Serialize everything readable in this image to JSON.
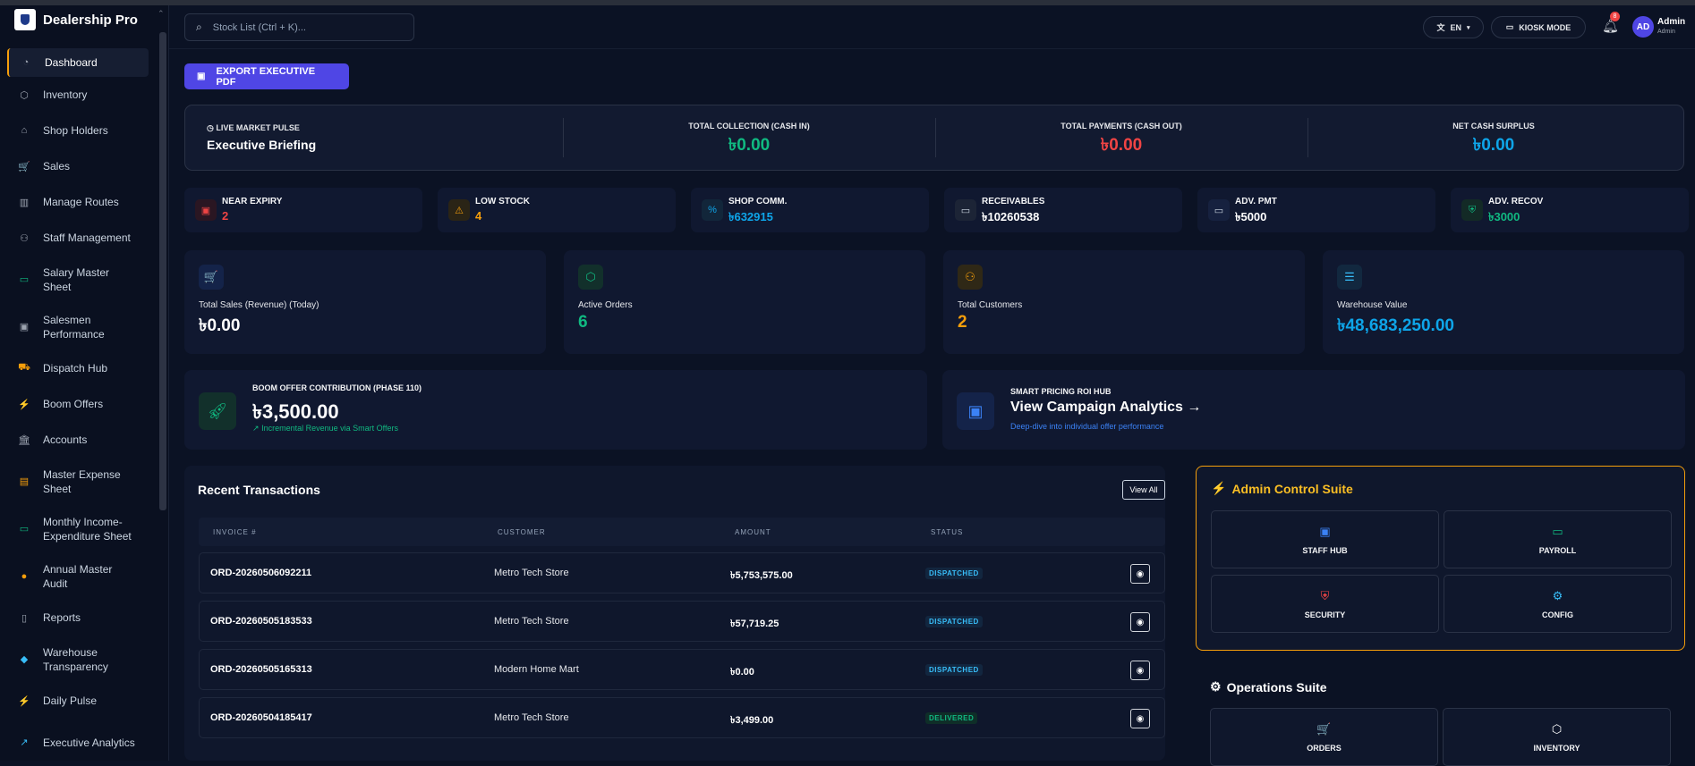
{
  "app": {
    "name": "Dealership Pro"
  },
  "sidebar": {
    "items": [
      {
        "label": "Dashboard",
        "icon": "dashboard-icon",
        "glyph": "◔",
        "color": "#9ca3af"
      },
      {
        "label": "Inventory",
        "icon": "box-icon",
        "glyph": "⬡",
        "color": "#9ca3af"
      },
      {
        "label": "Shop Holders",
        "icon": "store-icon",
        "glyph": "⌂",
        "color": "#9ca3af"
      },
      {
        "label": "Sales",
        "icon": "cart-icon",
        "glyph": "🛒",
        "color": "#9ca3af"
      },
      {
        "label": "Manage Routes",
        "icon": "map-icon",
        "glyph": "▥",
        "color": "#9ca3af"
      },
      {
        "label": "Staff Management",
        "icon": "users-icon",
        "glyph": "⚇",
        "color": "#9ca3af"
      },
      {
        "label": "Salary Master Sheet",
        "icon": "wallet-icon",
        "glyph": "▭",
        "color": "#10b981"
      },
      {
        "label": "Salesmen Performance",
        "icon": "badge-icon",
        "glyph": "▣",
        "color": "#9ca3af"
      },
      {
        "label": "Dispatch Hub",
        "icon": "truck-icon",
        "glyph": "⛟",
        "color": "#f59e0b"
      },
      {
        "label": "Boom Offers",
        "icon": "bolt-icon",
        "glyph": "⚡",
        "color": "#9ca3af"
      },
      {
        "label": "Accounts",
        "icon": "bank-icon",
        "glyph": "🏛",
        "color": "#9ca3af"
      },
      {
        "label": "Master Expense Sheet",
        "icon": "receipt-icon",
        "glyph": "▤",
        "color": "#f59e0b"
      },
      {
        "label": "Monthly Income-Expenditure Sheet",
        "icon": "money-icon",
        "glyph": "▭",
        "color": "#10b981"
      },
      {
        "label": "Annual Master Audit",
        "icon": "lightbulb-icon",
        "glyph": "●",
        "color": "#f59e0b"
      },
      {
        "label": "Reports",
        "icon": "file-icon",
        "glyph": "▯",
        "color": "#9ca3af"
      },
      {
        "label": "Warehouse Transparency",
        "icon": "cube-icon",
        "glyph": "◆",
        "color": "#38bdf8"
      },
      {
        "label": "Daily Pulse",
        "icon": "bolt-icon",
        "glyph": "⚡",
        "color": "#f59e0b"
      },
      {
        "label": "Executive Analytics",
        "icon": "chart-icon",
        "glyph": "↗",
        "color": "#38bdf8"
      }
    ]
  },
  "header": {
    "search_placeholder": "Stock List (Ctrl + K)...",
    "lang": "EN",
    "kiosk": "KIOSK MODE",
    "notif_count": "8",
    "avatar_initials": "AD",
    "user_name": "Admin",
    "user_role": "Admin"
  },
  "export_label": "EXPORT EXECUTIVE PDF",
  "pulse": {
    "tag": "LIVE MARKET PULSE",
    "title": "Executive Briefing",
    "stats": [
      {
        "label": "TOTAL COLLECTION (CASH IN)",
        "value": "৳0.00",
        "color": "#10b981"
      },
      {
        "label": "TOTAL PAYMENTS (CASH OUT)",
        "value": "৳0.00",
        "color": "#ef4444"
      },
      {
        "label": "NET CASH SURPLUS",
        "value": "৳0.00",
        "color": "#0ea5e9"
      }
    ]
  },
  "mini": [
    {
      "label": "NEAR EXPIRY",
      "value": "2",
      "color": "#ef4444",
      "icon": "calendar-icon",
      "glyph": "▣",
      "bg": "#2a1622"
    },
    {
      "label": "LOW STOCK",
      "value": "4",
      "color": "#f59e0b",
      "icon": "warning-icon",
      "glyph": "⚠",
      "bg": "#2a2416"
    },
    {
      "label": "SHOP COMM.",
      "value": "৳632915",
      "color": "#0ea5e9",
      "icon": "percent-icon",
      "glyph": "%",
      "bg": "#12263a"
    },
    {
      "label": "RECEIVABLES",
      "value": "৳10260538",
      "color": "#ffffff",
      "icon": "wallet-icon",
      "glyph": "▭",
      "bg": "#1c2436"
    },
    {
      "label": "ADV. PMT",
      "value": "৳5000",
      "color": "#ffffff",
      "icon": "cash-icon",
      "glyph": "▭",
      "bg": "#16213f"
    },
    {
      "label": "ADV. RECOV",
      "value": "৳3000",
      "color": "#10b981",
      "icon": "shield-icon",
      "glyph": "⛨",
      "bg": "#132a26"
    }
  ],
  "kpis": [
    {
      "label": "Total Sales (Revenue) (Today)",
      "value": "৳0.00",
      "color": "#ffffff",
      "icon": "cart-icon",
      "glyph": "🛒",
      "icolor": "#3b82f6",
      "bg": "#142349"
    },
    {
      "label": "Active Orders",
      "value": "6",
      "color": "#10b981",
      "icon": "box-icon",
      "glyph": "⬡",
      "icolor": "#10b981",
      "bg": "#12302b"
    },
    {
      "label": "Total Customers",
      "value": "2",
      "color": "#f59e0b",
      "icon": "users-icon",
      "glyph": "⚇",
      "icolor": "#f59e0b",
      "bg": "#2f2816"
    },
    {
      "label": "Warehouse Value",
      "value": "৳48,683,250.00",
      "color": "#0ea5e9",
      "icon": "database-icon",
      "glyph": "☰",
      "icolor": "#38bdf8",
      "bg": "#12283f"
    }
  ],
  "boom": {
    "label": "BOOM OFFER CONTRIBUTION (PHASE 110)",
    "value": "৳3,500.00",
    "sub": "Incremental Revenue via Smart Offers"
  },
  "roi": {
    "label": "SMART PRICING ROI HUB",
    "title": "View Campaign Analytics",
    "sub": "Deep-dive into individual offer performance"
  },
  "transactions": {
    "title": "Recent Transactions",
    "view_all": "View All",
    "columns": [
      "INVOICE #",
      "CUSTOMER",
      "AMOUNT",
      "STATUS"
    ],
    "rows": [
      {
        "invoice": "ORD-20260506092211",
        "customer": "Metro Tech Store",
        "amount": "৳5,753,575.00",
        "status": "DISPATCHED"
      },
      {
        "invoice": "ORD-20260505183533",
        "customer": "Metro Tech Store",
        "amount": "৳57,719.25",
        "status": "DISPATCHED"
      },
      {
        "invoice": "ORD-20260505165313",
        "customer": "Modern Home Mart",
        "amount": "৳0.00",
        "status": "DISPATCHED"
      },
      {
        "invoice": "ORD-20260504185417",
        "customer": "Metro Tech Store",
        "amount": "৳3,499.00",
        "status": "DELIVERED"
      }
    ]
  },
  "admin_suite": {
    "title": "Admin Control Suite",
    "tiles": [
      {
        "label": "STAFF HUB",
        "icon": "id-card-icon",
        "glyph": "▣",
        "color": "#3b82f6"
      },
      {
        "label": "PAYROLL",
        "icon": "wallet-icon",
        "glyph": "▭",
        "color": "#10b981"
      },
      {
        "label": "SECURITY",
        "icon": "shield-icon",
        "glyph": "⛨",
        "color": "#ef4444"
      },
      {
        "label": "CONFIG",
        "icon": "gear-icon",
        "glyph": "⚙",
        "color": "#38bdf8"
      }
    ]
  },
  "ops_suite": {
    "title": "Operations Suite",
    "tiles": [
      {
        "label": "ORDERS",
        "icon": "cart-icon",
        "glyph": "🛒",
        "color": "#ffffff"
      },
      {
        "label": "INVENTORY",
        "icon": "box-icon",
        "glyph": "⬡",
        "color": "#ffffff"
      }
    ]
  }
}
